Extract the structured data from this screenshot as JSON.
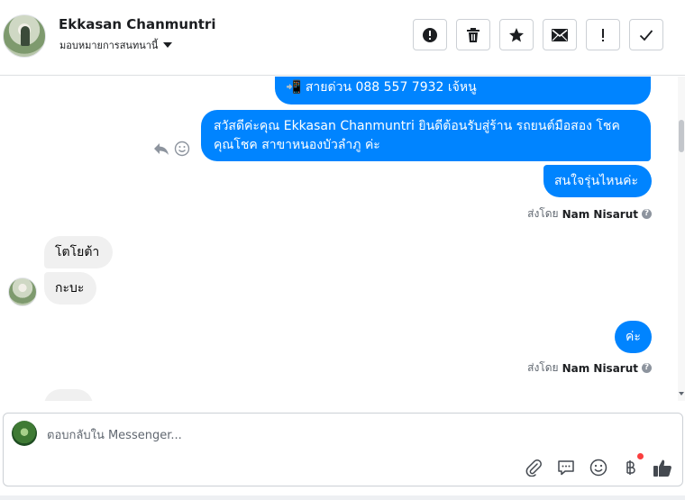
{
  "header": {
    "contact_name": "Ekkasan Chanmuntri",
    "assign_label": "มอบหมายการสนทนานี้",
    "tools": [
      {
        "name": "mark-spam-button",
        "icon": "alert-circle-icon"
      },
      {
        "name": "delete-button",
        "icon": "trash-icon"
      },
      {
        "name": "star-button",
        "icon": "star-icon"
      },
      {
        "name": "mark-unread-button",
        "icon": "envelope-icon"
      },
      {
        "name": "follow-up-button",
        "icon": "exclamation-icon"
      },
      {
        "name": "mark-done-button",
        "icon": "checkmark-icon"
      }
    ]
  },
  "conversation": {
    "messages": {
      "hotline": "📲 สายด่วน 088 557 7932 เจ้หนู",
      "greeting": "สวัสดีค่ะคุณ Ekkasan Chanmuntri ยินดีต้อนรับสู่ร้าน รถยนต์มือสอง โชคคุณโชค สาขาหนองบัวลำภู ค่ะ",
      "which_model": "สนใจรุ่นไหนค่ะ",
      "toyota": "โตโยต้า",
      "pickup": "กะบะ",
      "kha": "ค่ะ"
    },
    "sent_by_prefix": "ส่งโดย",
    "sent_by_name": "Nam Nisarut",
    "help_glyph": "?"
  },
  "composer": {
    "placeholder": "ตอบกลับใน Messenger...",
    "icons": [
      "paperclip-icon",
      "saved-reply-icon",
      "emoji-icon",
      "baht-payment-icon",
      "thumbs-up-icon"
    ]
  },
  "colors": {
    "outgoing_bubble": "#0084ff",
    "incoming_bubble": "#f0f0f0",
    "notification_dot": "#fa3e3e"
  }
}
